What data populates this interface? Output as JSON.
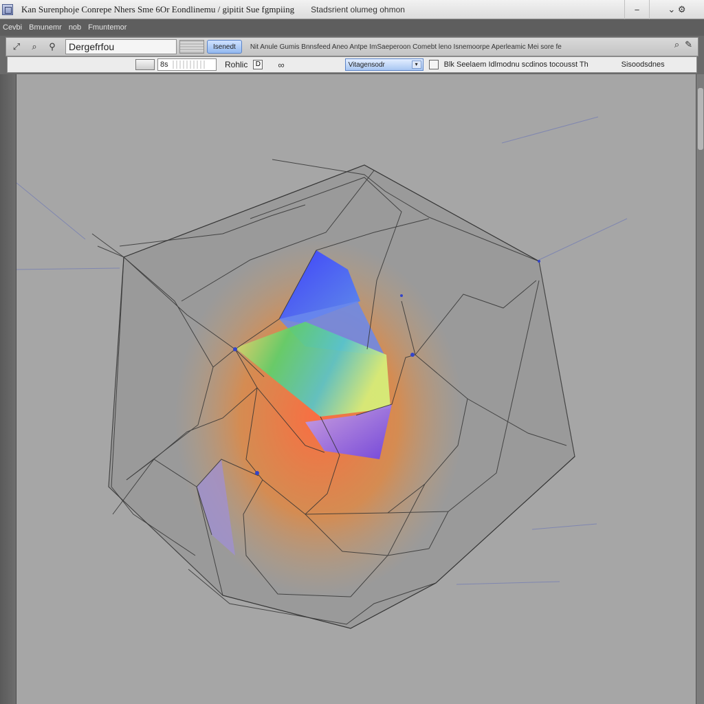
{
  "window": {
    "title": "Kan Surenphoje Conrepe Nhers Sme 6Or Eondlinemu / gipitit Sue fgmpiing",
    "subtitle": "Stadsrient olumeg ohmon",
    "controls": [
      "−",
      "⌄ ⚙"
    ]
  },
  "menubar": {
    "items": [
      "Cevbi",
      "Bmunemr",
      "nob",
      "Fmuntemor"
    ]
  },
  "toolbar1": {
    "name_value": "Dergefrfou",
    "pill_label": "Isenedt",
    "long_text": "Nit Anule Gumis Bnnsfeed Aneo Antpe ImSaeperoon Comebt leno Isnemoorpe Aperleamic Mei sore fe",
    "right_icons": [
      "⌕",
      "✎"
    ]
  },
  "toolbar2": {
    "numeric_value": "8s",
    "label": "Rohlic",
    "check_label": "D",
    "select_value": "Vitagensodr",
    "description": "Blk Seelaem Idlmodnu scdinos tocousst Th",
    "right_label": "Sisoodsdnes"
  },
  "canvas": {
    "background": "#a6a6a6",
    "shape": "translucent-polyhedron-wireframe"
  },
  "colors": {
    "accent_blue": "#93b9f0",
    "panel": "#d9d9d9"
  }
}
